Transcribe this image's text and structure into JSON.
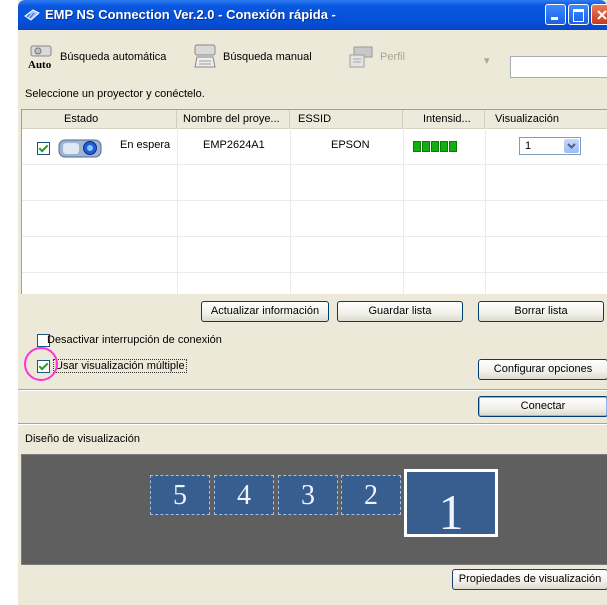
{
  "window": {
    "title": "EMP NS Connection Ver.2.0 - Conexión rápida -"
  },
  "toolbar": {
    "auto_search_label": "Búsqueda automática",
    "auto_icon_text": "Auto",
    "manual_search_label": "Búsqueda manual",
    "profile_label": "Perfil",
    "dropdown_glyph": "▾"
  },
  "instruction": "Seleccione un proyector y conéctelo.",
  "projector_list": {
    "columns": [
      "Estado",
      "Nombre del proye...",
      "ESSID",
      "Intensid...",
      "Visualización"
    ],
    "rows": [
      {
        "checked": true,
        "status": "En espera",
        "name": "EMP2624A1",
        "essid": "EPSON",
        "signal_bars": 5,
        "display": "1"
      }
    ]
  },
  "buttons": {
    "update_info": "Actualizar información",
    "save_list": "Guardar lista",
    "clear_list": "Borrar lista",
    "configure_options": "Configurar opciones",
    "connect": "Conectar",
    "display_properties": "Propiedades de visualización"
  },
  "options": {
    "disable_interrupt": {
      "label": "Desactivar interrupción de conexión",
      "checked": false
    },
    "use_multi_display": {
      "label": "Usar visualización múltiple",
      "checked": true
    }
  },
  "display_layout": {
    "title": "Diseño de visualización",
    "displays": [
      "5",
      "4",
      "3",
      "2",
      "1"
    ],
    "selected": "1"
  },
  "colors": {
    "titlebar": "#0550d8",
    "window_bg": "#ece9d8",
    "layout_bg": "#5f5f5f",
    "display_tile": "#375e8e",
    "signal": "#12b00e",
    "highlight_circle": "#ff34d8"
  }
}
